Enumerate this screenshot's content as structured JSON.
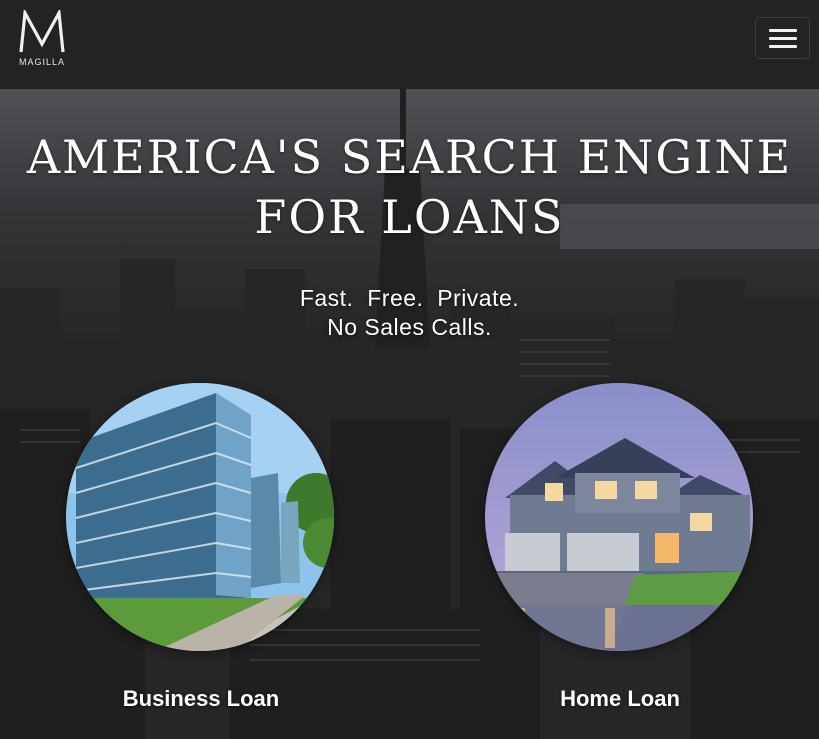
{
  "header": {
    "logo_text": "MAGILLA",
    "logo_icon": "magilla-m-logo",
    "menu_icon": "hamburger-menu-icon",
    "background": "#232323"
  },
  "hero": {
    "headline_lines": [
      "AMERICA'S SEARCH ENGINE",
      "FOR LOANS"
    ],
    "tagline_lines": [
      "Fast.  Free.  Private.",
      "No Sales Calls."
    ],
    "loans": [
      {
        "label": "Business Loan",
        "image": "office-building-image"
      },
      {
        "label": "Home Loan",
        "image": "house-image"
      }
    ]
  }
}
